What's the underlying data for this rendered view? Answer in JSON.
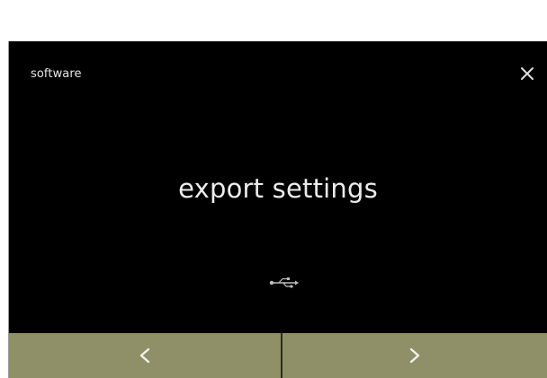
{
  "screen": {
    "title": "software",
    "heading": "export settings"
  },
  "icons": {
    "close": "close-icon",
    "usb": "usb-icon",
    "prev": "chevron-left-icon",
    "next": "chevron-right-icon"
  },
  "colors": {
    "screen_background": "#000000",
    "text": "#e6e6e6",
    "nav_bar": "#8f9067",
    "nav_divider": "#2b2b1f"
  }
}
